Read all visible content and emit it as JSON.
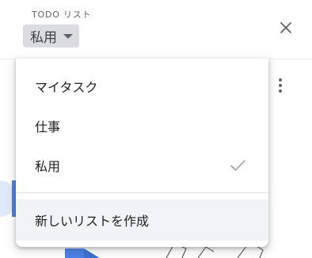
{
  "header": {
    "caption": "TODO リスト",
    "current_list": "私用",
    "close_icon": "close-icon",
    "caret_icon": "caret-down-icon"
  },
  "menu": {
    "items": [
      {
        "label": "マイタスク",
        "selected": false
      },
      {
        "label": "仕事",
        "selected": false
      },
      {
        "label": "私用",
        "selected": true
      }
    ],
    "check_icon": "check-icon",
    "create_label": "新しいリストを作成"
  },
  "background": {
    "more_icon": "more-vert-icon"
  },
  "colors": {
    "selector_bg": "#dadce0",
    "hover_bg": "#f1f3f4",
    "accent": "#4a7fe6",
    "text": "#202124",
    "secondary_text": "#5f6368"
  }
}
